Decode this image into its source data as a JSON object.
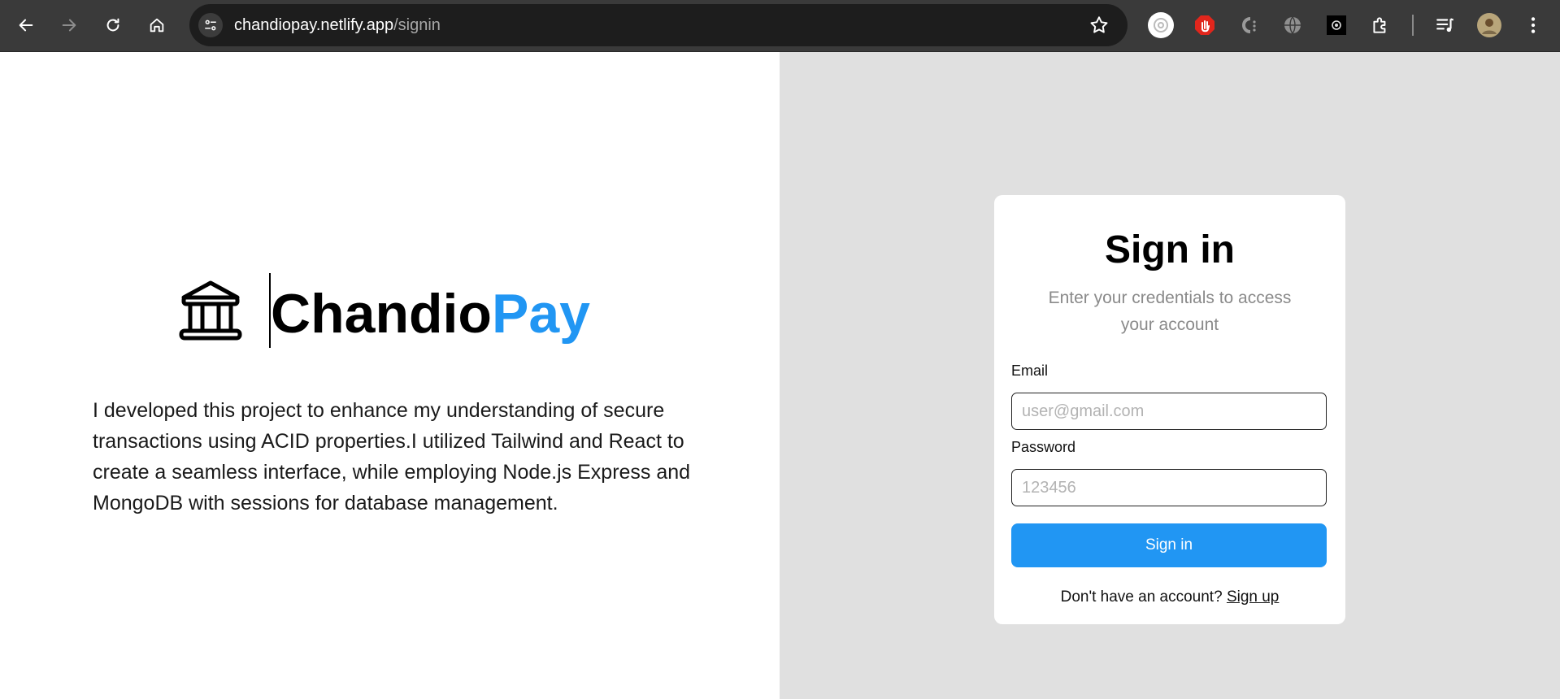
{
  "browser": {
    "url_host": "chandiopay.netlify.app",
    "url_path": "/signin"
  },
  "brand": {
    "name_dark": "Chandio",
    "name_accent": "Pay",
    "accent_color": "#2196f3"
  },
  "about": {
    "text": "I developed this project to enhance my understanding of secure transactions using ACID properties.I utilized Tailwind and React to create a seamless interface, while employing Node.js Express and MongoDB with sessions for database management."
  },
  "signin": {
    "title": "Sign in",
    "subtitle": "Enter your credentials to access your account",
    "email_label": "Email",
    "email_placeholder": "user@gmail.com",
    "password_label": "Password",
    "password_placeholder": "123456",
    "submit_label": "Sign in",
    "footer_text": "Don't have an account?",
    "signup_link": "Sign up"
  },
  "icons": {
    "back": "arrow-left-icon",
    "forward": "arrow-right-icon",
    "reload": "reload-icon",
    "home": "home-icon",
    "site_info": "tune-icon",
    "bookmark": "star-icon",
    "logo": "bank-icon"
  }
}
